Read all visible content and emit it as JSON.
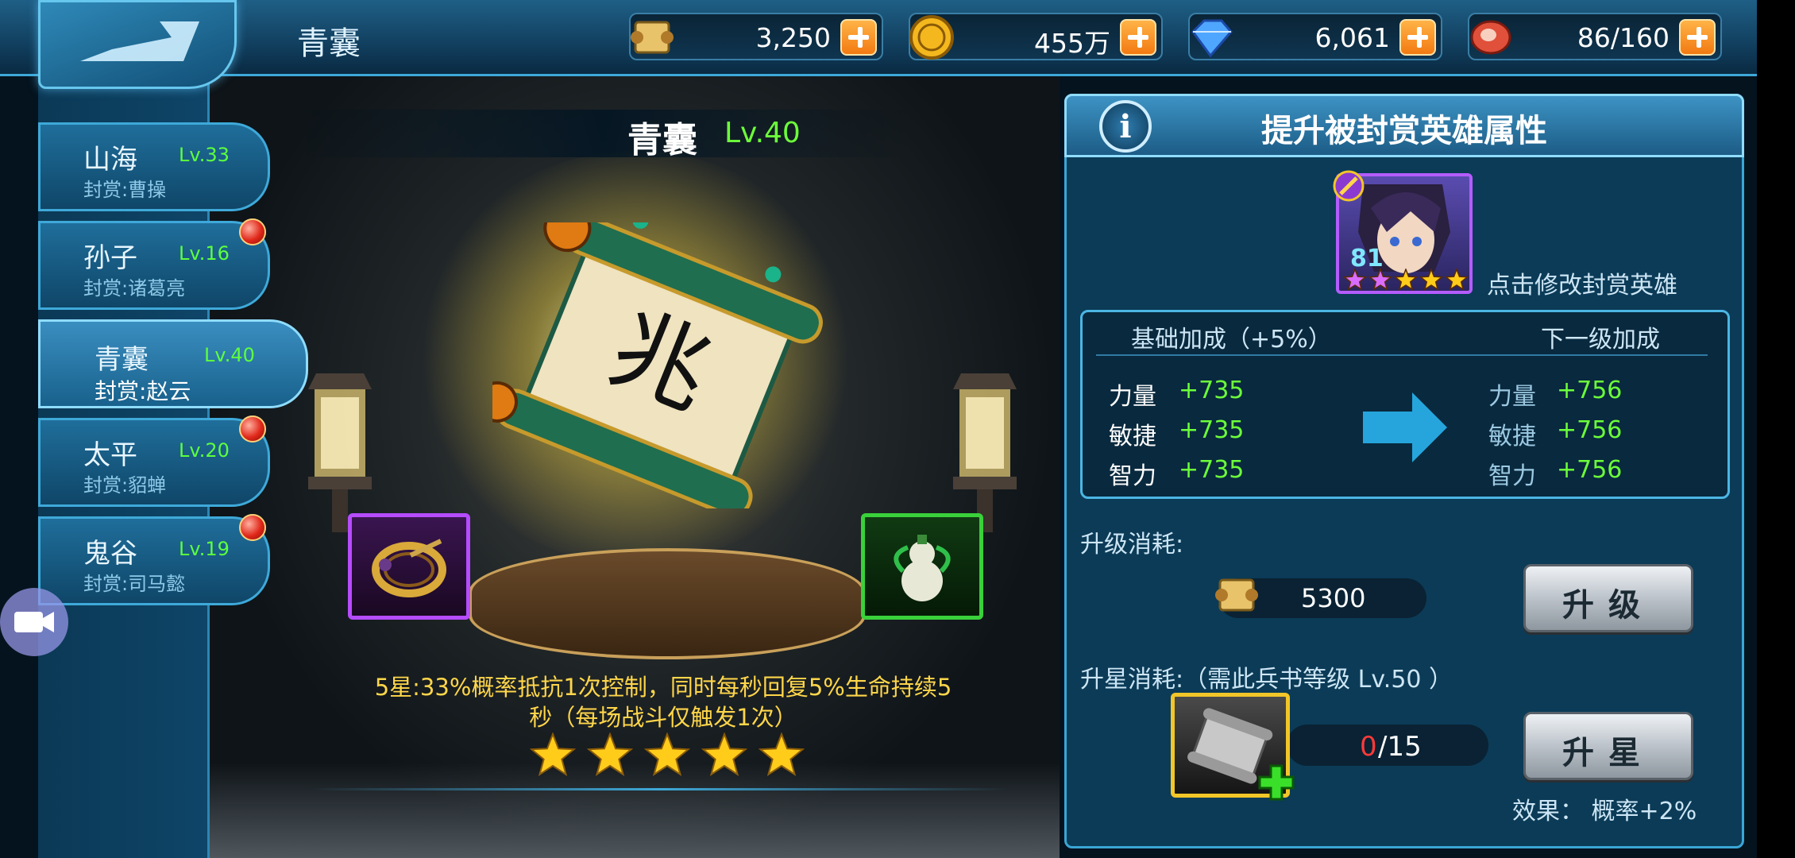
{
  "top_bar": {
    "title": "青囊",
    "resources": [
      {
        "icon": "scroll-currency-icon",
        "value": "3,250"
      },
      {
        "icon": "gold-coin-icon",
        "value": "455万"
      },
      {
        "icon": "diamond-icon",
        "value": "6,061"
      },
      {
        "icon": "meat-stamina-icon",
        "value": "86/160"
      }
    ]
  },
  "sidebar": {
    "tabs": [
      {
        "name": "山海",
        "level": "Lv.33",
        "reward": "封赏:曹操",
        "badge": false
      },
      {
        "name": "孙子",
        "level": "Lv.16",
        "reward": "封赏:诸葛亮",
        "badge": true
      },
      {
        "name": "青囊",
        "level": "Lv.40",
        "reward": "封赏:赵云",
        "badge": false,
        "active": true
      },
      {
        "name": "太平",
        "level": "Lv.20",
        "reward": "封赏:貂蝉",
        "badge": true
      },
      {
        "name": "鬼谷",
        "level": "Lv.19",
        "reward": "封赏:司马懿",
        "badge": true
      }
    ]
  },
  "center": {
    "book_name": "青囊",
    "book_level": "Lv.40",
    "skill_desc_line1": "5星:33%概率抵抗1次控制，同时每秒回复5%生命持续5",
    "skill_desc_line2": "秒（每场战斗仅触发1次）",
    "stars": 5,
    "equip_left_icon": "bracelet-icon",
    "equip_right_icon": "gourd-icon"
  },
  "panel": {
    "title": "提升被封赏英雄属性",
    "hero_level": "81",
    "hero_stars": 5,
    "hint": "点击修改封赏英雄",
    "base_header": "基础加成（+5%）",
    "next_header": "下一级加成",
    "stats_current": [
      {
        "name": "力量",
        "value": "+735"
      },
      {
        "name": "敏捷",
        "value": "+735"
      },
      {
        "name": "智力",
        "value": "+735"
      }
    ],
    "stats_next": [
      {
        "name": "力量",
        "value": "+756"
      },
      {
        "name": "敏捷",
        "value": "+756"
      },
      {
        "name": "智力",
        "value": "+756"
      }
    ],
    "upgrade_cost_label": "升级消耗:",
    "upgrade_cost_value": "5300",
    "upgrade_button": "升级",
    "star_cost_label": "升星消耗:（需此兵书等级 Lv.50 ）",
    "material_have": "0",
    "material_need": "/15",
    "star_button": "升星",
    "effect": "效果：  概率+2%"
  },
  "colors": {
    "level_green": "#6cff3a",
    "desc_yellow": "#ffd64a",
    "frame_blue": "#3aa6d6",
    "epic_purple": "#b64cff"
  }
}
